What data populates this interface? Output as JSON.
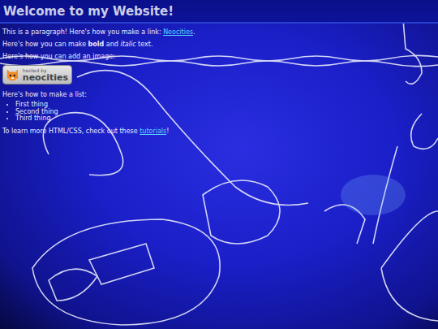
{
  "header": {
    "title": "Welcome to my Website!"
  },
  "link_paragraph": {
    "before": "This is a paragraph! Here's how you make a link: ",
    "link": "Neocities",
    "after": "."
  },
  "format_paragraph": {
    "before": "Here's how you can make ",
    "bold": "bold",
    "middle": " and ",
    "italic": "italic",
    "after": " text."
  },
  "image_paragraph": "Here's how you can add an image:",
  "badge": {
    "small": "hosted by",
    "large": "neocities"
  },
  "list_paragraph": "Here's how to make a list:",
  "list": [
    "First thing",
    "Second thing",
    "Third thing"
  ],
  "outro": {
    "before": "To learn more HTML/CSS, check out these ",
    "link": "tutorials",
    "after": "!"
  }
}
